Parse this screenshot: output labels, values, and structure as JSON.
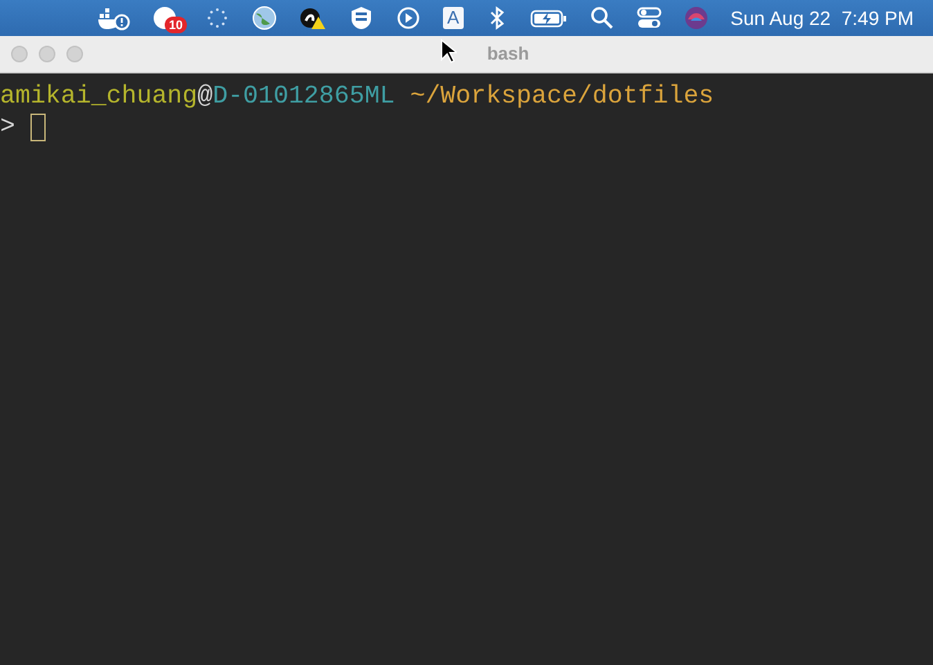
{
  "menu_bar": {
    "badge_count": "10",
    "input_source": "A",
    "clock": "Sun Aug 22  7:49 PM"
  },
  "window": {
    "title": "bash",
    "active": false
  },
  "terminal": {
    "lines": [
      {
        "segments": [
          {
            "text": "amikai_chuang",
            "color": "#b5b52c"
          },
          {
            "text": "@",
            "color": "#d6d6d6"
          },
          {
            "text": "D-01012865ML",
            "color": "#3f9ea3"
          },
          {
            "text": " ~/Workspace/dotfiles",
            "color": "#dba43c"
          }
        ],
        "cursor": false
      },
      {
        "segments": [
          {
            "text": "> ",
            "color": "#d6d6d6"
          }
        ],
        "cursor": true
      }
    ]
  }
}
